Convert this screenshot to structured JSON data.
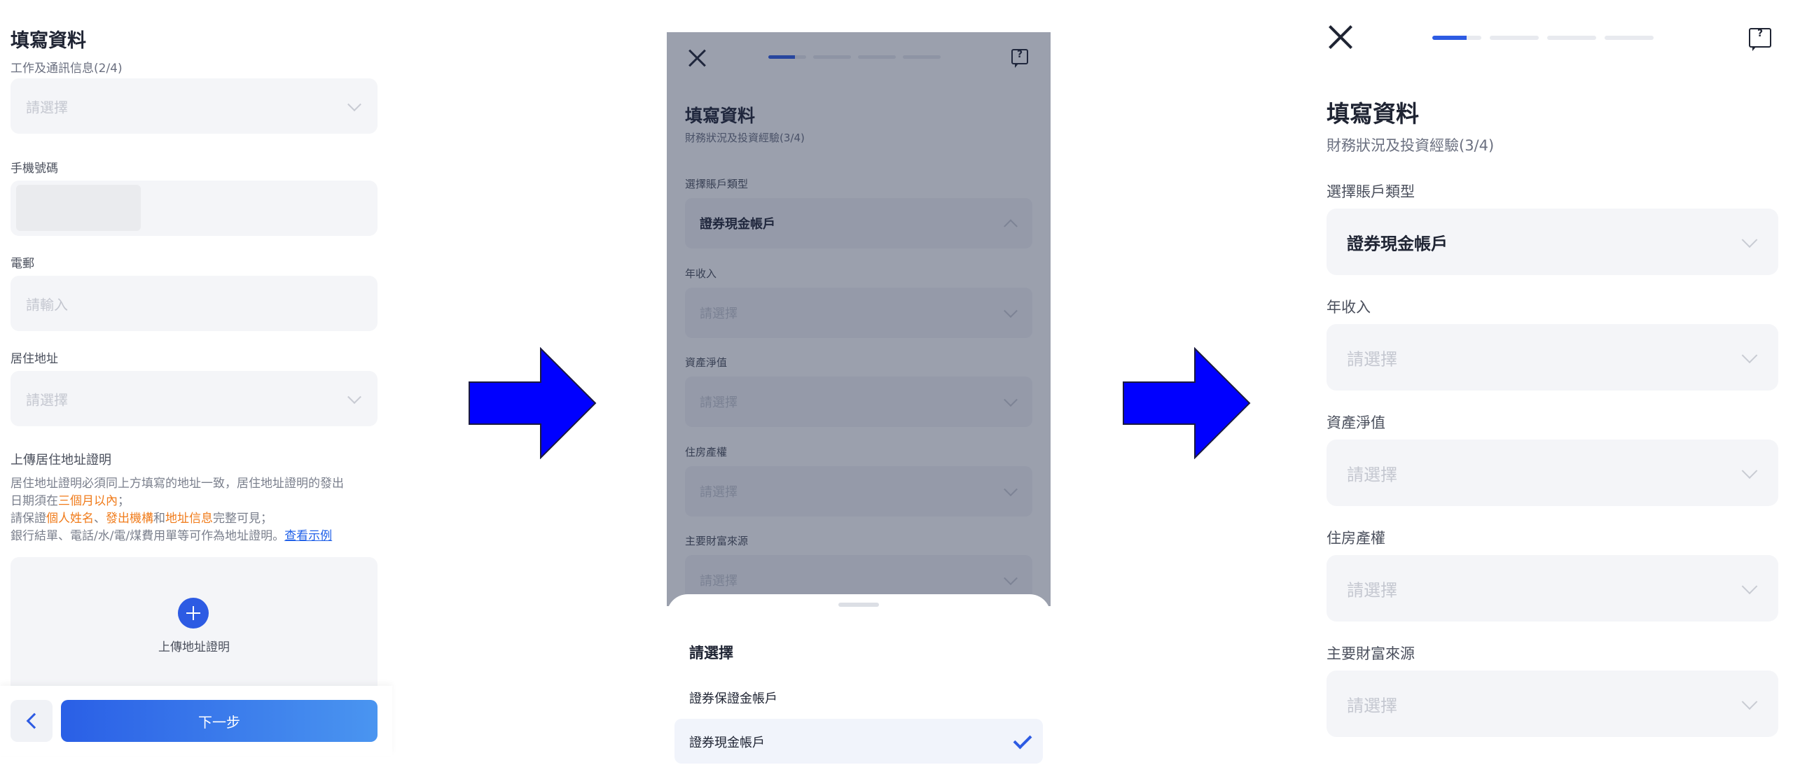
{
  "panel1": {
    "title": "填寫資料",
    "subtitle": "工作及通訊信息(2/4)",
    "fields": [
      {
        "label": "",
        "placeholder": "請選擇",
        "type": "select"
      },
      {
        "label": "手機號碼",
        "placeholder": "",
        "type": "masked"
      },
      {
        "label": "電郵",
        "placeholder": "請輸入",
        "type": "input"
      },
      {
        "label": "居住地址",
        "placeholder": "請選擇",
        "type": "select"
      }
    ],
    "upload": {
      "title": "上傳居住地址證明",
      "line1": "居住地址證明必須同上方填寫的地址一致，居住地址證明的發出",
      "line2_a": "日期須在",
      "line2_hl": "三個月以內",
      "line2_b": "；",
      "line3_a": "請保證",
      "line3_hl1": "個人姓名",
      "line3_sep1": "、",
      "line3_hl2": "發出機構",
      "line3_sep2": "和",
      "line3_hl3": "地址信息",
      "line3_b": "完整可見；",
      "line4_a": "銀行結單、電話/水/電/煤費用單等可作為地址證明。",
      "line4_link": "查看示例",
      "button_label": "上傳地址證明"
    },
    "next_label": "下一步"
  },
  "panel2": {
    "title": "填寫資料",
    "subtitle": "財務狀況及投資經驗(3/4)",
    "fields": [
      {
        "label": "選擇賬戶類型",
        "value": "證券現金帳戶"
      },
      {
        "label": "年收入",
        "placeholder": "請選擇"
      },
      {
        "label": "資產淨值",
        "placeholder": "請選擇"
      },
      {
        "label": "住房產權",
        "placeholder": "請選擇"
      },
      {
        "label": "主要財富來源",
        "placeholder": "請選擇"
      }
    ],
    "sheet": {
      "title": "請選擇",
      "options": [
        "證券保證金帳戶",
        "證券現金帳戶"
      ],
      "selected": "證券現金帳戶"
    },
    "progress_step": 1,
    "progress_total": 4
  },
  "panel3": {
    "title": "填寫資料",
    "subtitle": "財務狀況及投資經驗(3/4)",
    "fields": [
      {
        "label": "選擇賬戶類型",
        "value": "證券現金帳戶"
      },
      {
        "label": "年收入",
        "placeholder": "請選擇"
      },
      {
        "label": "資產淨值",
        "placeholder": "請選擇"
      },
      {
        "label": "住房產權",
        "placeholder": "請選擇"
      },
      {
        "label": "主要財富來源",
        "placeholder": "請選擇"
      }
    ],
    "progress_step": 1,
    "progress_total": 4
  },
  "colors": {
    "accent": "#2d5be3",
    "highlight": "#f07b1a",
    "link": "#2060e8",
    "arrow": "#0000ff"
  }
}
